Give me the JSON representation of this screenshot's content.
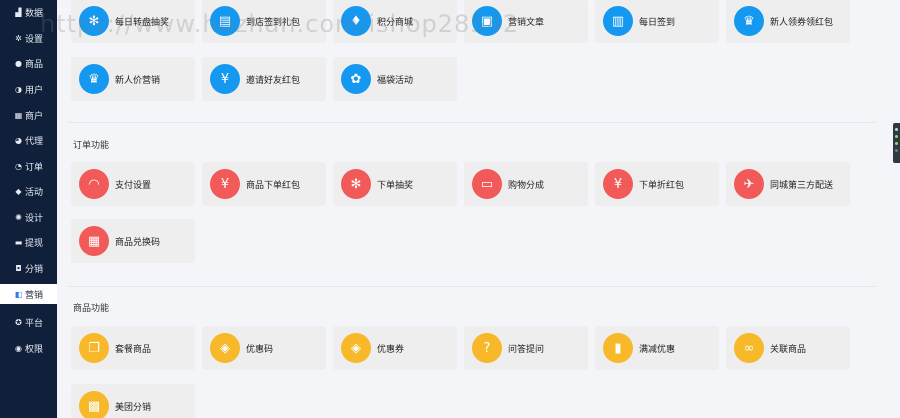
{
  "sidebar": {
    "items": [
      {
        "label": "数据",
        "icon": "bar-chart-icon",
        "active": false
      },
      {
        "label": "设置",
        "icon": "gear-icon",
        "active": false
      },
      {
        "label": "商品",
        "icon": "circle-icon",
        "active": false
      },
      {
        "label": "用户",
        "icon": "user-icon",
        "active": false
      },
      {
        "label": "商户",
        "icon": "grid-icon",
        "active": false
      },
      {
        "label": "代理",
        "icon": "user-tie-icon",
        "active": false
      },
      {
        "label": "订单",
        "icon": "order-icon",
        "active": false
      },
      {
        "label": "活动",
        "icon": "tag-icon",
        "active": false
      },
      {
        "label": "设计",
        "icon": "palette-icon",
        "active": false
      },
      {
        "label": "提现",
        "icon": "card-icon",
        "active": false
      },
      {
        "label": "分销",
        "icon": "share-icon",
        "active": false
      },
      {
        "label": "营销",
        "icon": "cube-icon",
        "active": true
      },
      {
        "label": "平台",
        "icon": "compass-icon",
        "active": false
      },
      {
        "label": "权限",
        "icon": "shield-icon",
        "active": false
      }
    ]
  },
  "sections": {
    "marketing_cards": [
      {
        "label": "每日转盘抽奖",
        "icon": "wheel-icon",
        "color": "#1599f0"
      },
      {
        "label": "到店签到礼包",
        "icon": "gift-icon",
        "color": "#1599f0"
      },
      {
        "label": "积分商城",
        "icon": "points-mall-icon",
        "color": "#1599f0"
      },
      {
        "label": "营销文章",
        "icon": "article-icon",
        "color": "#1599f0"
      },
      {
        "label": "每日签到",
        "icon": "calendar-icon",
        "color": "#1599f0"
      },
      {
        "label": "新人领券领红包",
        "icon": "crown-new-icon",
        "color": "#1599f0"
      },
      {
        "label": "新人价营销",
        "icon": "crown-new-icon",
        "color": "#1599f0"
      },
      {
        "label": "邀请好友红包",
        "icon": "red-packet-icon",
        "color": "#1599f0"
      },
      {
        "label": "福袋活动",
        "icon": "lucky-bag-icon",
        "color": "#1599f0"
      }
    ],
    "order": {
      "title": "订单功能",
      "cards": [
        {
          "label": "支付设置",
          "icon": "payment-icon",
          "color": "#f25a5a"
        },
        {
          "label": "商品下单红包",
          "icon": "red-packet-icon",
          "color": "#f25a5a"
        },
        {
          "label": "下单抽奖",
          "icon": "wheel-icon",
          "color": "#f25a5a"
        },
        {
          "label": "购物分成",
          "icon": "gift-box-icon",
          "color": "#f25a5a"
        },
        {
          "label": "下单折红包",
          "icon": "red-packet-icon",
          "color": "#f25a5a"
        },
        {
          "label": "同城第三方配送",
          "icon": "scooter-icon",
          "color": "#f25a5a"
        },
        {
          "label": "商品兑换码",
          "icon": "qrcode-icon",
          "color": "#f25a5a"
        }
      ]
    },
    "goods": {
      "title": "商品功能",
      "cards": [
        {
          "label": "套餐商品",
          "icon": "package-icon",
          "color": "#f7b929"
        },
        {
          "label": "优惠码",
          "icon": "ticket-icon",
          "color": "#f7b929"
        },
        {
          "label": "优惠券",
          "icon": "ticket-icon",
          "color": "#f7b929"
        },
        {
          "label": "问答提问",
          "icon": "question-icon",
          "color": "#f7b929"
        },
        {
          "label": "满减优惠",
          "icon": "coupon-icon",
          "color": "#f7b929"
        },
        {
          "label": "关联商品",
          "icon": "link-icon",
          "color": "#f7b929"
        },
        {
          "label": "美团分销",
          "icon": "meituan-icon",
          "color": "#f7b929"
        }
      ]
    }
  },
  "watermark": "https://www.huzhan.com/ishop28542"
}
